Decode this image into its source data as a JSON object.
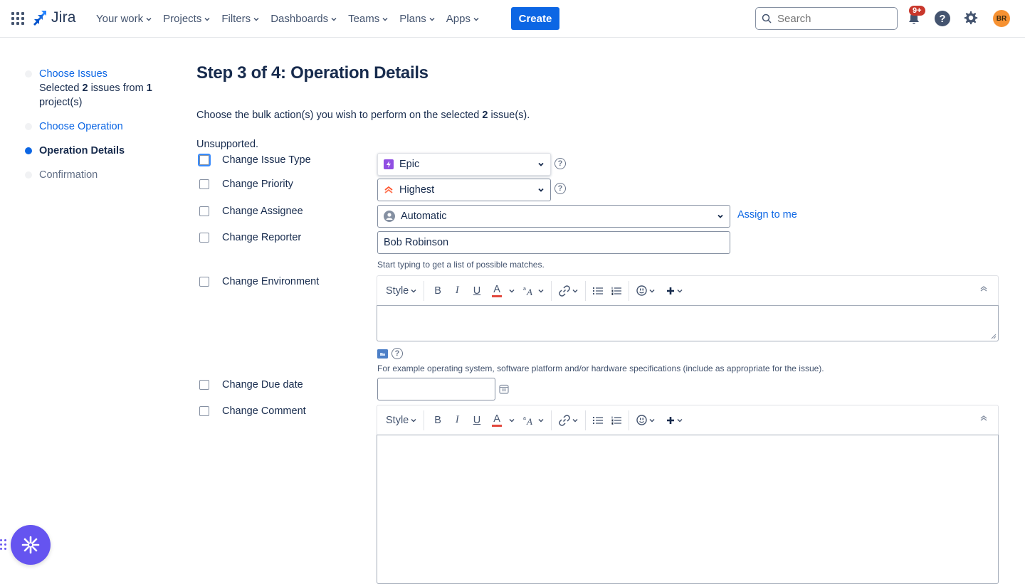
{
  "nav": {
    "app_name": "Jira",
    "items": [
      {
        "label": "Your work"
      },
      {
        "label": "Projects"
      },
      {
        "label": "Filters"
      },
      {
        "label": "Dashboards"
      },
      {
        "label": "Teams"
      },
      {
        "label": "Plans"
      },
      {
        "label": "Apps"
      }
    ],
    "create_label": "Create",
    "search_placeholder": "Search",
    "notifications_badge": "9+",
    "help_glyph": "?",
    "avatar_initials": "BR",
    "colors": {
      "brand": "#0c66e4",
      "avatar": "#f79232",
      "badge": "#c9372c"
    }
  },
  "steps": [
    {
      "label": "Choose Issues",
      "state": "done",
      "sub_prefix": "Selected ",
      "sub_count": "2",
      "sub_mid": " issues from ",
      "sub_projects": "1",
      "sub_suffix": " project(s)"
    },
    {
      "label": "Choose Operation",
      "state": "done"
    },
    {
      "label": "Operation Details",
      "state": "active"
    },
    {
      "label": "Confirmation",
      "state": "future"
    }
  ],
  "main": {
    "title": "Step 3 of 4: Operation Details",
    "intro_prefix": "Choose the bulk action(s) you wish to perform on the selected ",
    "intro_count": "2",
    "intro_suffix": " issue(s).",
    "unsupported": "Unsupported.",
    "fields": {
      "issue_type": {
        "label": "Change Issue Type",
        "value": "Epic",
        "checked": false
      },
      "priority": {
        "label": "Change Priority",
        "value": "Highest",
        "checked": false
      },
      "assignee": {
        "label": "Change Assignee",
        "value": "Automatic",
        "assign_to_me": "Assign to me",
        "checked": false
      },
      "reporter": {
        "label": "Change Reporter",
        "value": "Bob Robinson",
        "hint": "Start typing to get a list of possible matches.",
        "checked": false
      },
      "environment": {
        "label": "Change Environment",
        "value": "",
        "hint": "For example operating system, software platform and/or hardware specifications (include as appropriate for the issue).",
        "checked": false
      },
      "due_date": {
        "label": "Change Due date",
        "value": "",
        "checked": false
      },
      "comment": {
        "label": "Change Comment",
        "value": "",
        "checked": false
      }
    },
    "editor_toolbar": {
      "style": "Style",
      "bold": "B",
      "italic": "I",
      "underline": "U",
      "text_color": "A"
    }
  }
}
